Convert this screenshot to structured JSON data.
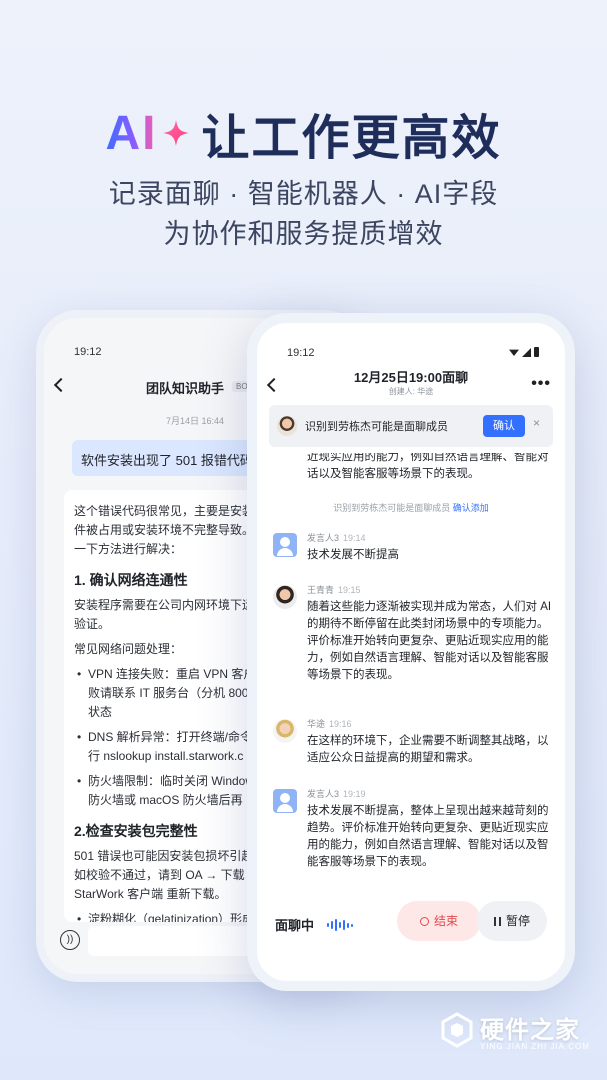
{
  "hero": {
    "ai": "AI",
    "title": "让工作更高效",
    "subtitle_line1": "记录面聊 · 智能机器人 · AI字段",
    "subtitle_line2": "为协作和服务提质增效"
  },
  "back_phone": {
    "time": "19:12",
    "title": "团队知识助手",
    "badge": "BOT",
    "date": "7月14日 16:44",
    "user_message": "软件安装出现了 501 报错代码,",
    "reply": {
      "intro": [
        "这个错误代码很常见，主要是安装",
        "件被占用或安装环境不完整导致。",
        "一下方法进行解决："
      ],
      "section1_title": "1. 确认网络连通性",
      "section1_body": [
        "安装程序需要在公司内网环境下运",
        "验证。"
      ],
      "section1_sub": "常见网络问题处理：",
      "section1_items": [
        [
          "VPN 连接失败：重启 VPN 客户",
          "败请联系 IT 服务台（分机 800",
          "状态"
        ],
        [
          "DNS 解析异常：打开终端/命令",
          "行 nslookup install.starwork.c"
        ],
        [
          "防火墙限制：临时关闭 Window",
          "防火墙或 macOS 防火墙后再"
        ]
      ],
      "section2_title": "2.检查安装包完整性",
      "section2_body": [
        "501 错误也可能因安装包损坏引起",
        "如校验不通过，请到 OA → 下载",
        "StarWork 客户端 重新下载。"
      ],
      "section2_items": [
        [
          "淀粉糊化（gelatinization）形成"
        ]
      ]
    }
  },
  "front_phone": {
    "time": "19:12",
    "title": "12月25日19:00面聊",
    "creator": "创建人: 华途",
    "banner": {
      "text": "识别到劳栋杰可能是面聊成员",
      "confirm": "确认",
      "close": "×"
    },
    "top_para": "近现实应用的能力，例如自然语言理解、智能对话以及智能客服等场景下的表现。",
    "system_notice": "识别到劳栋杰可能是面聊成员",
    "system_link": "确认添加",
    "messages": [
      {
        "speaker": "发言人3",
        "time": "19:14",
        "text": "技术发展不断提高"
      },
      {
        "speaker": "王青青",
        "time": "19:15",
        "text": "随着这些能力逐渐被实现并成为常态，人们对 AI 的期待不断停留在此类封闭场景中的专项能力。\n评价标准开始转向更复杂、更贴近现实应用的能力，例如自然语言理解、智能对话以及智能客服等场景下的表现。"
      },
      {
        "speaker": "华途",
        "time": "19:16",
        "text": "在这样的环境下，企业需要不断调整其战略，以适应公众日益提高的期望和需求。"
      },
      {
        "speaker": "发言人3",
        "time": "19:19",
        "text": "技术发展不断提高，整体上呈现出越来越苛刻的趋势。评价标准开始转向更复杂、更贴近现实应用的能力，例如自然语言理解、智能对话以及智能客服等场景下的表现。"
      }
    ],
    "state_label": "面聊中",
    "end_label": "结束",
    "pause_label": "暂停"
  },
  "watermark": {
    "name": "硬件之家",
    "url": "YING JIAN ZHI JIA.COM"
  },
  "colors": {
    "accent": "#3370ff",
    "end_red": "#e5484d",
    "title_dark": "#1f2d5a"
  }
}
